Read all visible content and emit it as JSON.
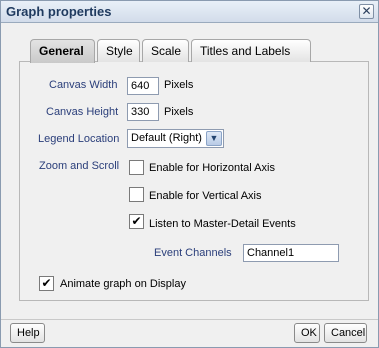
{
  "window": {
    "title": "Graph properties",
    "close_glyph": "✕"
  },
  "tabs": [
    {
      "label": "General"
    },
    {
      "label": "Style"
    },
    {
      "label": "Scale"
    },
    {
      "label": "Titles and Labels"
    }
  ],
  "form": {
    "canvas_width": {
      "label": "Canvas Width",
      "value": "640",
      "unit": "Pixels"
    },
    "canvas_height": {
      "label": "Canvas Height",
      "value": "330",
      "unit": "Pixels"
    },
    "legend_location": {
      "label": "Legend Location",
      "selected": "Default (Right)"
    },
    "zoom_scroll": {
      "label": "Zoom and Scroll",
      "options": [
        {
          "label": "Enable for Horizontal Axis",
          "checked": false
        },
        {
          "label": "Enable for Vertical Axis",
          "checked": false
        },
        {
          "label": "Listen to Master-Detail Events",
          "checked": true
        }
      ]
    },
    "event_channels": {
      "label": "Event Channels",
      "value": "Channel1"
    },
    "animate": {
      "label": "Animate graph on Display",
      "checked": true
    }
  },
  "footer": {
    "help_label": "Help",
    "ok_label": "OK",
    "cancel_label": "Cancel"
  },
  "check_glyph": "✔",
  "icons": {
    "close": "close-icon",
    "dropdown": "chevron-down-icon",
    "check": "checkmark-icon"
  }
}
